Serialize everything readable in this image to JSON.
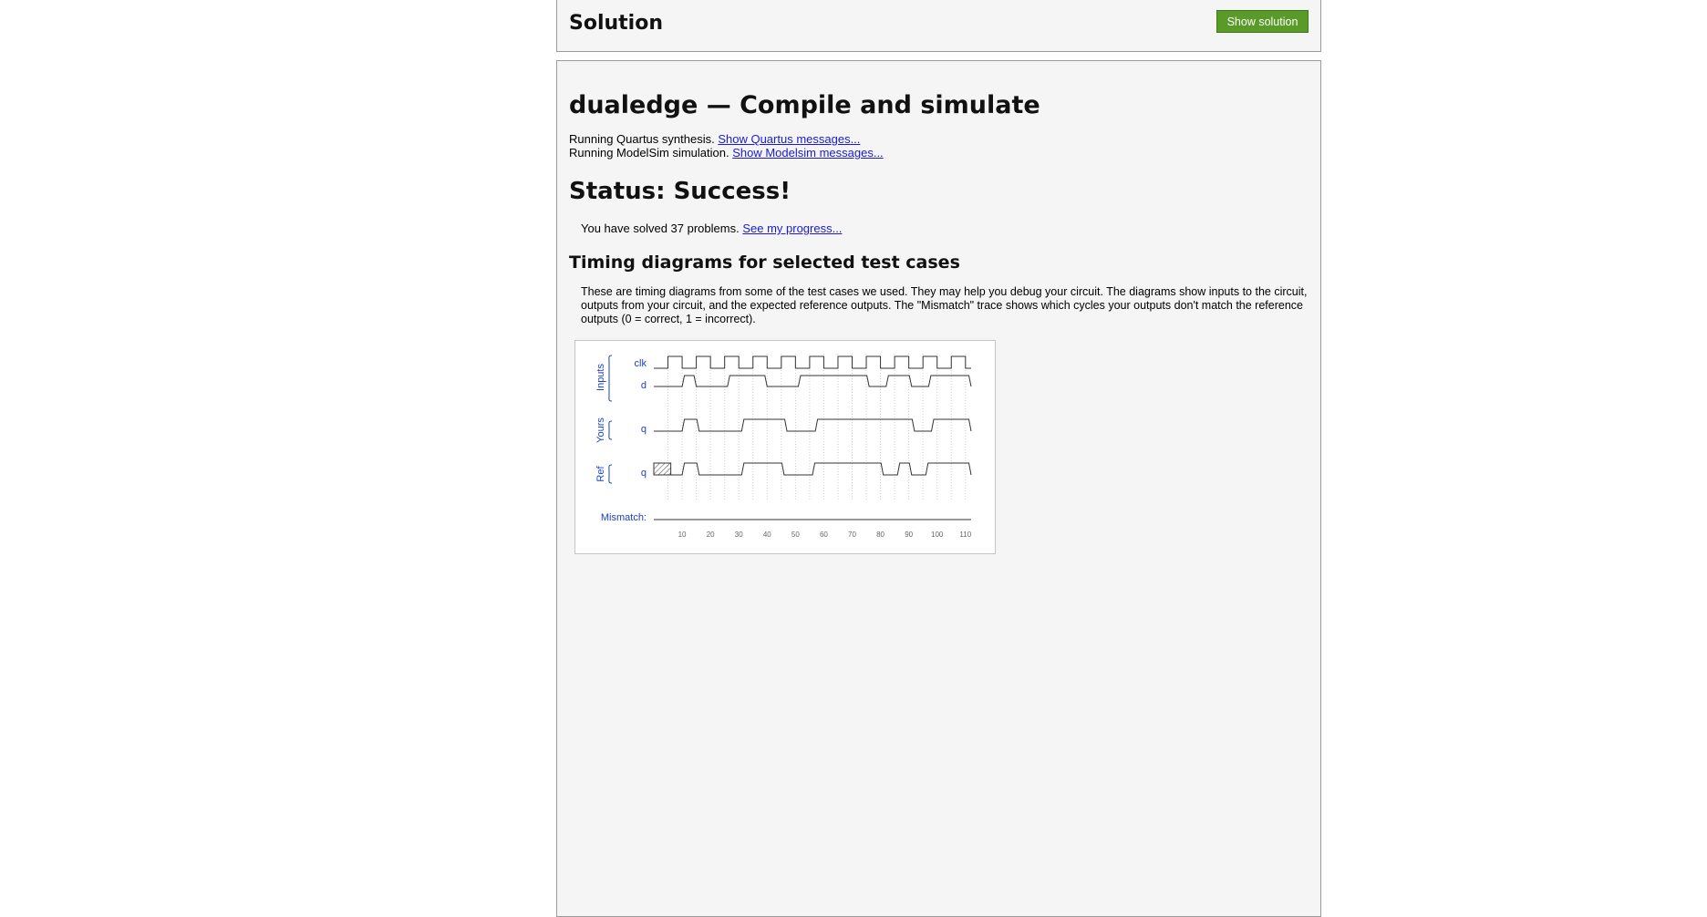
{
  "header": {
    "title": "Solution",
    "show_solution_label": "Show solution"
  },
  "main": {
    "title": "dualedge — Compile and simulate",
    "quartus_text": "Running Quartus synthesis.",
    "quartus_link": "Show Quartus messages...",
    "modelsim_text": "Running ModelSim simulation.",
    "modelsim_link": "Show Modelsim messages...",
    "status": "Status: Success!",
    "progress_text": "You have solved 37 problems.",
    "progress_link": "See my progress...",
    "timing_title": "Timing diagrams for selected test cases",
    "timing_description": "These are timing diagrams from some of the test cases we used. They may help you debug your circuit. The diagrams show inputs to the circuit, outputs from your circuit, and the expected reference outputs. The \"Mismatch\" trace shows which cycles your outputs don't match the reference outputs (0 = correct, 1 = incorrect)."
  },
  "colors": {
    "label_blue": "#1a3fc8",
    "button_green": "#5a9a28",
    "link_blue": "#1a1ad8"
  },
  "chart_data": {
    "type": "timing",
    "groups": [
      {
        "label": "Inputs",
        "signals": [
          "clk",
          "d"
        ]
      },
      {
        "label": "Yours",
        "signals": [
          "q"
        ]
      },
      {
        "label": "Ref",
        "signals": [
          "q"
        ]
      }
    ],
    "mismatch_label": "Mismatch:",
    "x_ticks": [
      "10",
      "20",
      "30",
      "40",
      "50",
      "60",
      "70",
      "80",
      "90",
      "100",
      "110"
    ],
    "x_range": [
      0,
      112
    ],
    "clk": {
      "initial": 0,
      "period": 10,
      "first_rise": 5
    },
    "d_pulses": [
      [
        10,
        15
      ],
      [
        26,
        40
      ],
      [
        51,
        76
      ],
      [
        82,
        91
      ],
      [
        97,
        112
      ]
    ],
    "yours_q_pulses": [
      [
        10,
        16
      ],
      [
        31,
        47
      ],
      [
        57,
        92
      ],
      [
        98,
        112
      ]
    ],
    "ref_q_pulses": [
      [
        10,
        16
      ],
      [
        31,
        46
      ],
      [
        56,
        81
      ],
      [
        86,
        91
      ],
      [
        96,
        112
      ]
    ],
    "ref_q_unknown": [
      0,
      6
    ],
    "mismatch": 0
  }
}
